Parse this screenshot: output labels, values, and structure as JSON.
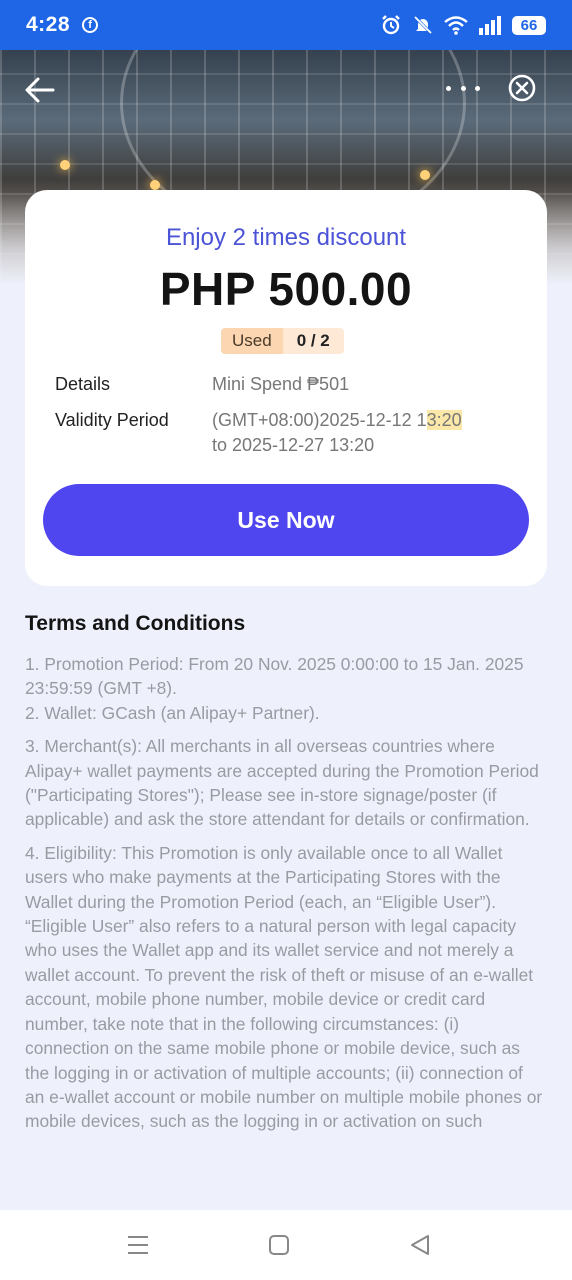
{
  "status_bar": {
    "time": "4:28",
    "battery": "66",
    "icons": [
      "facebook-icon",
      "alarm-icon",
      "mute-icon",
      "wifi-icon",
      "signal-icon",
      "battery-icon"
    ]
  },
  "header": {
    "back_icon": "arrow-left-icon",
    "more_icon": "more-dots-icon",
    "close_icon": "close-circle-icon"
  },
  "voucher": {
    "headline": "Enjoy 2 times discount",
    "amount": "PHP 500.00",
    "used_label": "Used",
    "used_count": "0 / 2",
    "details_label": "Details",
    "details_value": "Mini Spend ₱501",
    "validity_label": "Validity Period",
    "validity_start_prefix": "(GMT+08:00)2025-12-12 1",
    "validity_start_highlight": "3:20",
    "validity_end": "to 2025-12-27 13:20",
    "cta": "Use Now"
  },
  "terms": {
    "title": "Terms and Conditions",
    "item1": "1. Promotion Period: From 20 Nov. 2025 0:00:00 to 15 Jan. 2025 23:59:59 (GMT +8).",
    "item2": "2. Wallet: GCash (an Alipay+ Partner).",
    "item3": "3. Merchant(s): All merchants in all overseas countries where Alipay+ wallet payments are accepted during the Promotion Period (\"Participating Stores\"); Please see in-store signage/poster (if applicable) and ask the store attendant for details or confirmation.",
    "item4": "4. Eligibility: This Promotion is only available once to all Wallet users who make payments at the Participating Stores with the Wallet during the Promotion Period (each, an “Eligible User”). “Eligible User” also refers to a natural person with legal capacity who uses the Wallet app and its wallet service and not merely a wallet account. To prevent the risk of theft or misuse of an e-wallet account, mobile phone number, mobile device or credit card number, take note that in the following circumstances: (i) connection on the same mobile phone or mobile device, such as the logging in or activation of multiple accounts; (ii) connection of an e-wallet account or mobile number on multiple mobile phones or mobile devices, such as the logging in or activation on such"
  },
  "nav_bar": {
    "icons": [
      "recents-icon",
      "home-icon",
      "back-triangle-icon"
    ]
  }
}
